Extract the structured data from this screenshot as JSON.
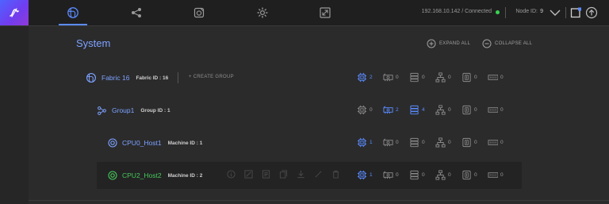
{
  "topbar": {
    "connection_text": "192.168.10.142 / Connected",
    "node_label": "Node ID:",
    "node_value": "9"
  },
  "page": {
    "title": "System",
    "expand_all": "EXPAND ALL",
    "collapse_all": "COLLAPSE ALL"
  },
  "tree": {
    "fabric": {
      "name": "Fabric 16",
      "id_text": "Fabric ID : 16",
      "create_group": "+ CREATE GROUP",
      "stats": [
        "2",
        "0",
        "0",
        "0",
        "0",
        "0"
      ]
    },
    "group": {
      "name": "Group1",
      "id_text": "Group ID : 1",
      "stats": [
        "0",
        "2",
        "4",
        "0",
        "0",
        "0"
      ]
    },
    "host1": {
      "name": "CPU0_Host1",
      "id_text": "Machine ID : 1",
      "stats": [
        "1",
        "0",
        "0",
        "0",
        "0",
        "0"
      ]
    },
    "host2": {
      "name": "CPU2_Host2",
      "id_text": "Machine ID : 2",
      "stats": [
        "1",
        "0",
        "0",
        "0",
        "0",
        "0"
      ]
    }
  },
  "colors": {
    "accent": "#5b8cff",
    "connected": "#39d353",
    "host_active": "#46c95a"
  },
  "icons": [
    "logo-icon",
    "globe-icon",
    "share-icon",
    "device-icon",
    "gear-icon",
    "resize-icon",
    "chevron-down-icon",
    "window-icon",
    "arrow-up-icon",
    "cpu-icon",
    "gpu-icon",
    "storage-icon",
    "network-icon",
    "memory-icon",
    "ram-icon"
  ]
}
